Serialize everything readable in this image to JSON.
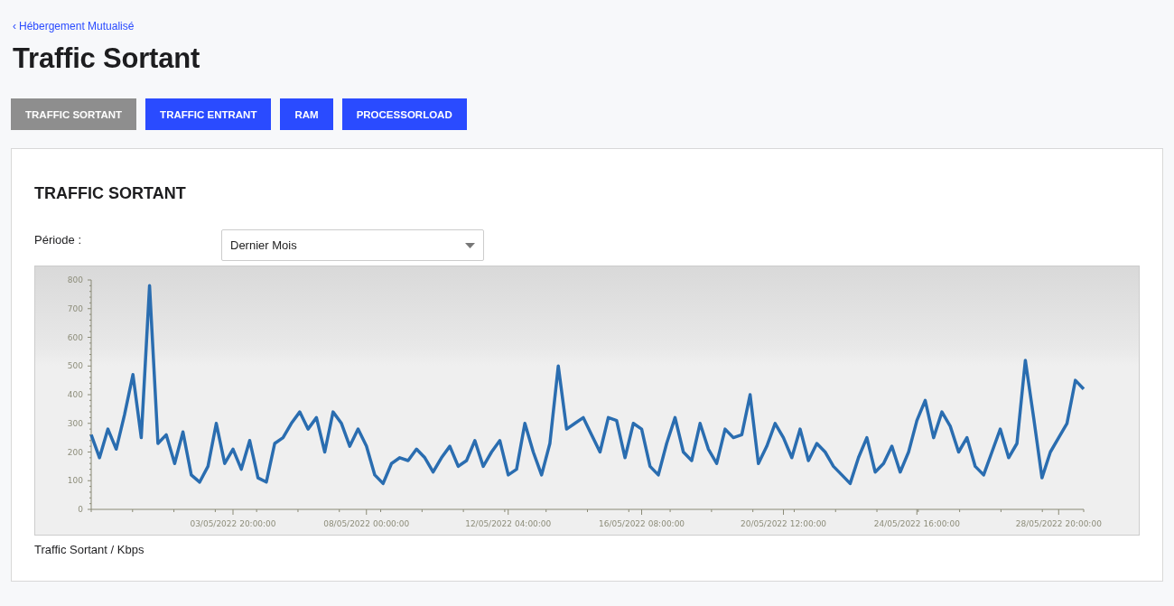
{
  "breadcrumb": {
    "icon": "‹",
    "label": "Hébergement Mutualisé"
  },
  "title": "Traffic Sortant",
  "tabs": [
    {
      "label": "TRAFFIC SORTANT",
      "selected": true
    },
    {
      "label": "TRAFFIC ENTRANT",
      "selected": false
    },
    {
      "label": "RAM",
      "selected": false
    },
    {
      "label": "PROCESSORLOAD",
      "selected": false
    }
  ],
  "card": {
    "title": "TRAFFIC SORTANT",
    "period": {
      "label": "Période :",
      "value": "Dernier Mois"
    },
    "chart_data": {
      "type": "line",
      "ylim": [
        0,
        800
      ],
      "categories": [
        null,
        null,
        null,
        null,
        null,
        null,
        null,
        null,
        null,
        null,
        null,
        null,
        null,
        null,
        null,
        null,
        null,
        "03/05/2022 20:00:00",
        null,
        null,
        null,
        null,
        null,
        null,
        null,
        null,
        null,
        null,
        null,
        null,
        null,
        null,
        null,
        "08/05/2022 00:00:00",
        null,
        null,
        null,
        null,
        null,
        null,
        null,
        null,
        null,
        null,
        null,
        null,
        null,
        null,
        null,
        null,
        "12/05/2022 04:00:00",
        null,
        null,
        null,
        null,
        null,
        null,
        null,
        null,
        null,
        null,
        null,
        null,
        null,
        null,
        null,
        "16/05/2022 08:00:00",
        null,
        null,
        null,
        null,
        null,
        null,
        null,
        null,
        null,
        null,
        null,
        null,
        null,
        null,
        null,
        null,
        "20/05/2022 12:00:00",
        null,
        null,
        null,
        null,
        null,
        null,
        null,
        null,
        null,
        null,
        null,
        null,
        null,
        null,
        null,
        "24/05/2022 16:00:00",
        null,
        null,
        null,
        null,
        null,
        null,
        null,
        null,
        null,
        null,
        null,
        null,
        null,
        null,
        null,
        null,
        "28/05/2022 20:00:00",
        null,
        null,
        null
      ],
      "yticks": [
        0,
        100,
        200,
        300,
        400,
        500,
        600,
        700,
        800
      ],
      "series": [
        {
          "color": "#2a6db0",
          "values": [
            260,
            180,
            280,
            210,
            330,
            470,
            250,
            780,
            230,
            260,
            160,
            270,
            120,
            95,
            150,
            300,
            160,
            210,
            140,
            240,
            110,
            95,
            230,
            250,
            300,
            340,
            280,
            320,
            200,
            340,
            300,
            220,
            280,
            220,
            120,
            90,
            160,
            180,
            170,
            210,
            180,
            130,
            180,
            220,
            150,
            170,
            240,
            150,
            200,
            240,
            120,
            140,
            300,
            200,
            120,
            230,
            500,
            280,
            300,
            320,
            260,
            200,
            320,
            310,
            180,
            300,
            280,
            150,
            120,
            230,
            320,
            200,
            170,
            300,
            210,
            160,
            280,
            250,
            260,
            400,
            160,
            220,
            300,
            250,
            180,
            280,
            170,
            230,
            200,
            150,
            120,
            90,
            180,
            250,
            130,
            160,
            220,
            130,
            200,
            310,
            380,
            250,
            340,
            290,
            200,
            250,
            150,
            120,
            200,
            280,
            180,
            230,
            520,
            320,
            110,
            200,
            250,
            300,
            450,
            420
          ]
        }
      ]
    },
    "caption": "Traffic Sortant / Kbps"
  }
}
